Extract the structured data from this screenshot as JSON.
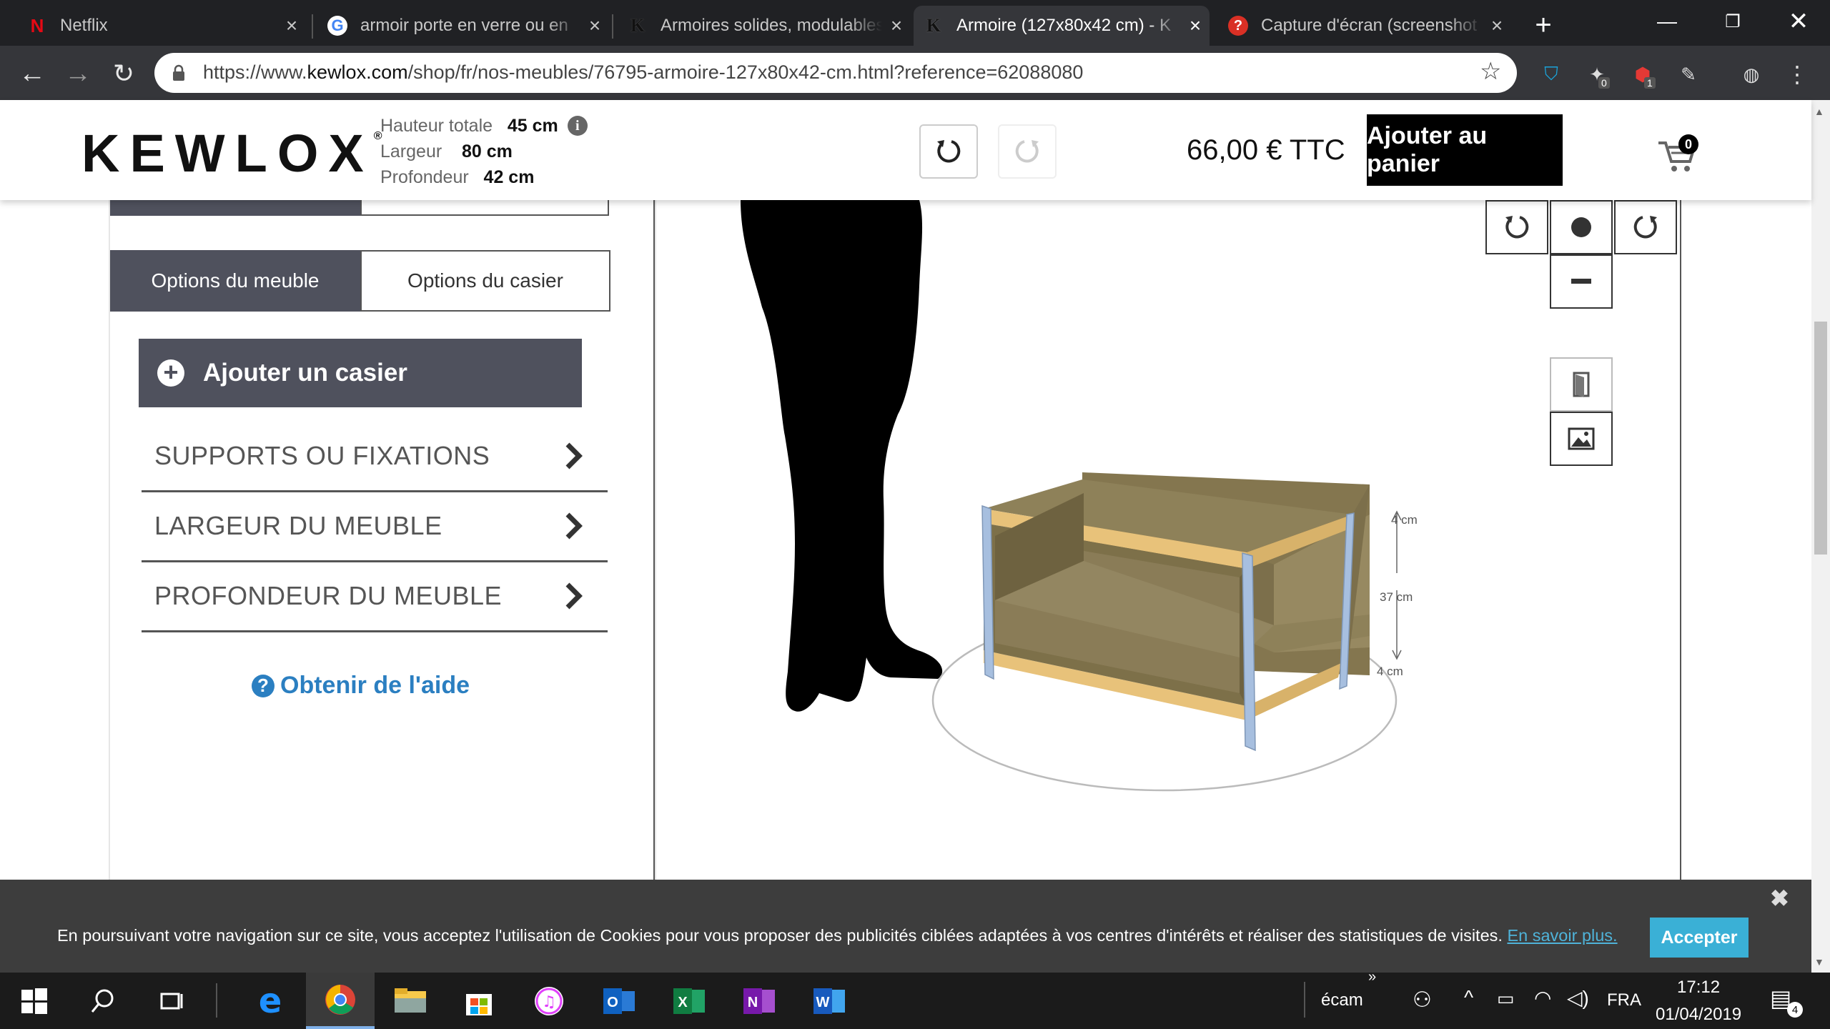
{
  "browser": {
    "tabs": [
      {
        "title": "Netflix",
        "favicon": "N"
      },
      {
        "title": "armoir porte en verre ou en",
        "favicon": "G"
      },
      {
        "title": "Armoires solides, modulables",
        "favicon": "K"
      },
      {
        "title": "Armoire (127x80x42 cm) - K",
        "favicon": "K"
      },
      {
        "title": "Capture d'écran (screenshot",
        "favicon": "?"
      }
    ],
    "url_prefix": "https://www.",
    "url_host": "kewlox.com",
    "url_path": "/shop/fr/nos-meubles/76795-armoire-127x80x42-cm.html?reference=62088080",
    "ext_badge_1": "0",
    "ext_badge_2": "1"
  },
  "header": {
    "logo": "KEWLOX",
    "logo_mark": "®",
    "height_label": "Hauteur totale",
    "height_value": "45 cm",
    "width_label": "Largeur",
    "width_value": "80 cm",
    "depth_label": "Profondeur",
    "depth_value": "42 cm",
    "price": "66,00 € TTC",
    "add_to_cart": "Ajouter au panier",
    "cart_count": "0"
  },
  "panel": {
    "tab_furniture": "Options du meuble",
    "tab_locker": "Options du casier",
    "add_locker": "Ajouter un casier",
    "sections": [
      "SUPPORTS OU FIXATIONS",
      "LARGEUR DU MEUBLE",
      "PROFONDEUR DU MEUBLE"
    ],
    "help": "Obtenir de l'aide"
  },
  "viewer": {
    "dim_top": "4 cm",
    "dim_mid": "37 cm",
    "dim_bottom": "4 cm"
  },
  "cookie": {
    "text": "En poursuivant votre navigation sur ce site, vous acceptez l'utilisation de Cookies pour vous proposer des publicités ciblées adaptées à vos centres d'intérêts et réaliser des statistiques de visites.",
    "link": "En savoir plus.",
    "accept": "Accepter",
    "close": "✖"
  },
  "taskbar": {
    "search_label": "écam",
    "language": "FRA",
    "time": "17:12",
    "date": "01/04/2019",
    "notifications": "4"
  },
  "colors": {
    "panel_dark": "#4f515d",
    "link_blue": "#2b7fc1",
    "accept_blue": "#3ab0d6",
    "wood": "#8a7c57",
    "edge": "#e8c27a",
    "leg": "#a7bfdf"
  }
}
